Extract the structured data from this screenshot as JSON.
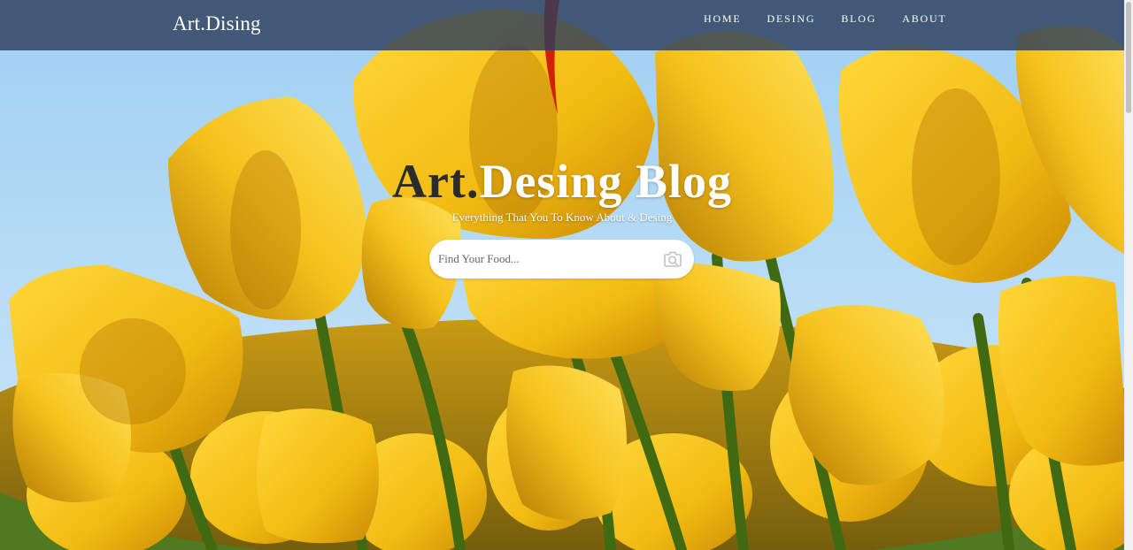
{
  "brand": {
    "logo": "Art.Dising"
  },
  "nav": {
    "items": [
      {
        "label": "HOME"
      },
      {
        "label": "DESING"
      },
      {
        "label": "BLOG"
      },
      {
        "label": "ABOUT"
      }
    ]
  },
  "hero": {
    "title_accent": "Art.",
    "title_rest": "Desing Blog",
    "subtitle": "Everything That You To Know About & Desing",
    "background": "yellow tulips against blue sky"
  },
  "search": {
    "placeholder": "Find Your Food...",
    "value": "",
    "icon": "camera-search-icon"
  },
  "colors": {
    "navbar": "#2c3e5a",
    "accent_text": "#2b2b2b",
    "sky": "#8fc6ee",
    "tulip": "#f2c21a"
  }
}
